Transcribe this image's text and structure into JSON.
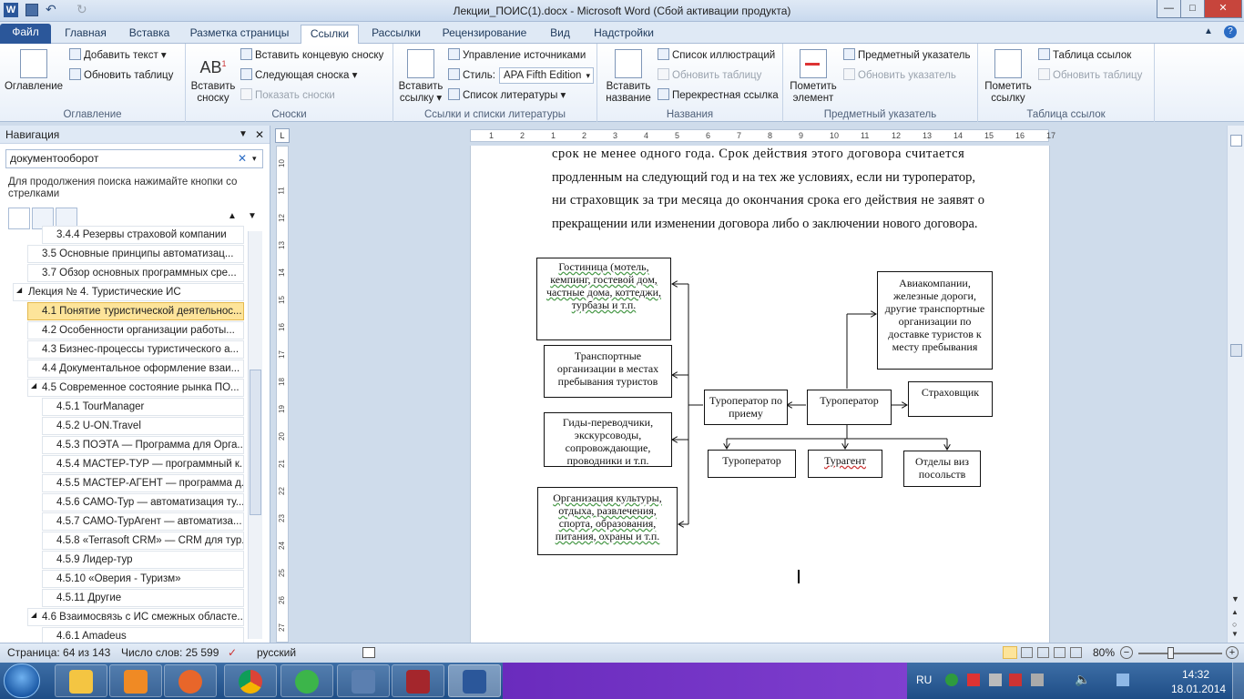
{
  "window": {
    "title": "Лекции_ПОИС(1).docx - Microsoft Word (Сбой активации продукта)",
    "minimize": "—",
    "maximize": "□",
    "close": "✕"
  },
  "tabs": [
    "Файл",
    "Главная",
    "Вставка",
    "Разметка страницы",
    "Ссылки",
    "Рассылки",
    "Рецензирование",
    "Вид",
    "Надстройки"
  ],
  "ribbon": {
    "toc": {
      "big": "Оглавление",
      "add_text": "Добавить текст",
      "update": "Обновить таблицу",
      "label": "Оглавление"
    },
    "footnotes": {
      "big": "Вставить сноску",
      "insert_end": "Вставить концевую сноску",
      "next": "Следующая сноска",
      "show": "Показать сноски",
      "label": "Сноски"
    },
    "citations": {
      "big": "Вставить ссылку",
      "manage": "Управление источниками",
      "style_label": "Стиль:",
      "style_value": "APA Fifth Edition",
      "bibliography": "Список литературы",
      "label": "Ссылки и списки литературы"
    },
    "captions": {
      "big": "Вставить название",
      "figures": "Список иллюстраций",
      "update": "Обновить таблицу",
      "crossref": "Перекрестная ссылка",
      "label": "Названия"
    },
    "index": {
      "big": "Пометить элемент",
      "insert": "Предметный указатель",
      "update": "Обновить указатель",
      "label": "Предметный указатель"
    },
    "authorities": {
      "big": "Пометить ссылку",
      "insert": "Таблица ссылок",
      "update": "Обновить таблицу",
      "label": "Таблица ссылок"
    }
  },
  "nav": {
    "title": "Навигация",
    "search_value": "документооборот",
    "hint": "Для продолжения поиска нажимайте кнопки со стрелками",
    "items": [
      {
        "text": "3.4.4 Резервы страховой компании",
        "level": 3
      },
      {
        "text": "3.5 Основные принципы автоматизац...",
        "level": 2
      },
      {
        "text": "3.7 Обзор основных программных сре...",
        "level": 2
      },
      {
        "text": "Лекция № 4. Туристические ИС",
        "level": 1
      },
      {
        "text": "4.1 Понятие туристической деятельнос...",
        "level": 2,
        "selected": true
      },
      {
        "text": "4.2 Особенности организации работы...",
        "level": 2
      },
      {
        "text": "4.3 Бизнес-процессы туристического а...",
        "level": 2
      },
      {
        "text": "4.4 Документальное оформление взаи...",
        "level": 2
      },
      {
        "text": "4.5 Современное состояние рынка ПО...",
        "level": 2
      },
      {
        "text": "4.5.1 TourManager",
        "level": 3
      },
      {
        "text": "4.5.2 U-ON.Travel",
        "level": 3
      },
      {
        "text": "4.5.3 ПОЭТА — Программа для Орга...",
        "level": 3
      },
      {
        "text": "4.5.4 МАСТЕР-ТУР — программный к...",
        "level": 3
      },
      {
        "text": "4.5.5 МАСТЕР-АГЕНТ — программа д...",
        "level": 3
      },
      {
        "text": "4.5.6 САМО-Тур — автоматизация ту...",
        "level": 3
      },
      {
        "text": "4.5.7 САМО-ТурАгент — автоматиза...",
        "level": 3
      },
      {
        "text": "4.5.8 «Terrasoft CRM» — CRM для тур...",
        "level": 3
      },
      {
        "text": "4.5.9 Лидер-тур",
        "level": 3
      },
      {
        "text": "4.5.10  «Оверия - Туризм»",
        "level": 3
      },
      {
        "text": "4.5.11 Другие",
        "level": 3
      },
      {
        "text": "4.6 Взаимосвязь с ИС смежных областе...",
        "level": 2
      },
      {
        "text": "4.6.1 Amadeus",
        "level": 3
      }
    ]
  },
  "document": {
    "lines": [
      "срок  не  менее  одного  года.  Срок  действия  этого  договора  считается",
      "продленным на следующий год и на тех же условиях, если ни туроператор,",
      "ни страховщик за три месяца до окончания срока его действия не заявят о",
      "прекращении или изменении договора либо о заключении нового договора."
    ],
    "diagram": {
      "hotel": "Гостиница (мотель, кемпинг, гостевой дом, частные дома, коттеджи, турбазы и т.п.",
      "transport_local": "Транспортные организации в местах пребывания туристов",
      "guides": "Гиды-переводчики, экскурсоводы, сопровождающие, проводники и т.п.",
      "culture": "Организация культуры, отдыха, развлечения, спорта, образования, питания, охраны и т.п.",
      "receiving_operator": "Туроператор по приему",
      "operator": "Туроператор",
      "insurer": "Страховщик",
      "airlines": "Авиакомпании, железные дороги, другие транспортные организации по доставке туристов к месту пребывания",
      "operator2": "Туроператор",
      "agent": "Турагент",
      "visa": "Отделы виз посольств"
    }
  },
  "ruler": {
    "h_marks": [
      "1",
      "2",
      "1",
      "2",
      "3",
      "4",
      "5",
      "6",
      "7",
      "8",
      "9",
      "10",
      "11",
      "12",
      "13",
      "14",
      "15",
      "16",
      "17"
    ],
    "v_marks": [
      "10",
      "11",
      "12",
      "13",
      "14",
      "15",
      "16",
      "17",
      "18",
      "19",
      "20",
      "21",
      "22",
      "23",
      "24",
      "25",
      "26",
      "27"
    ]
  },
  "status": {
    "page": "Страница: 64 из 143",
    "words": "Число слов: 25 599",
    "lang": "русский",
    "zoom": "80%"
  },
  "taskbar": {
    "lang": "RU",
    "time": "14:32",
    "date": "18.01.2014"
  },
  "colors": {
    "accent": "#2b579a",
    "selected": "#fde49a",
    "taskbar": "#1e4d86"
  }
}
